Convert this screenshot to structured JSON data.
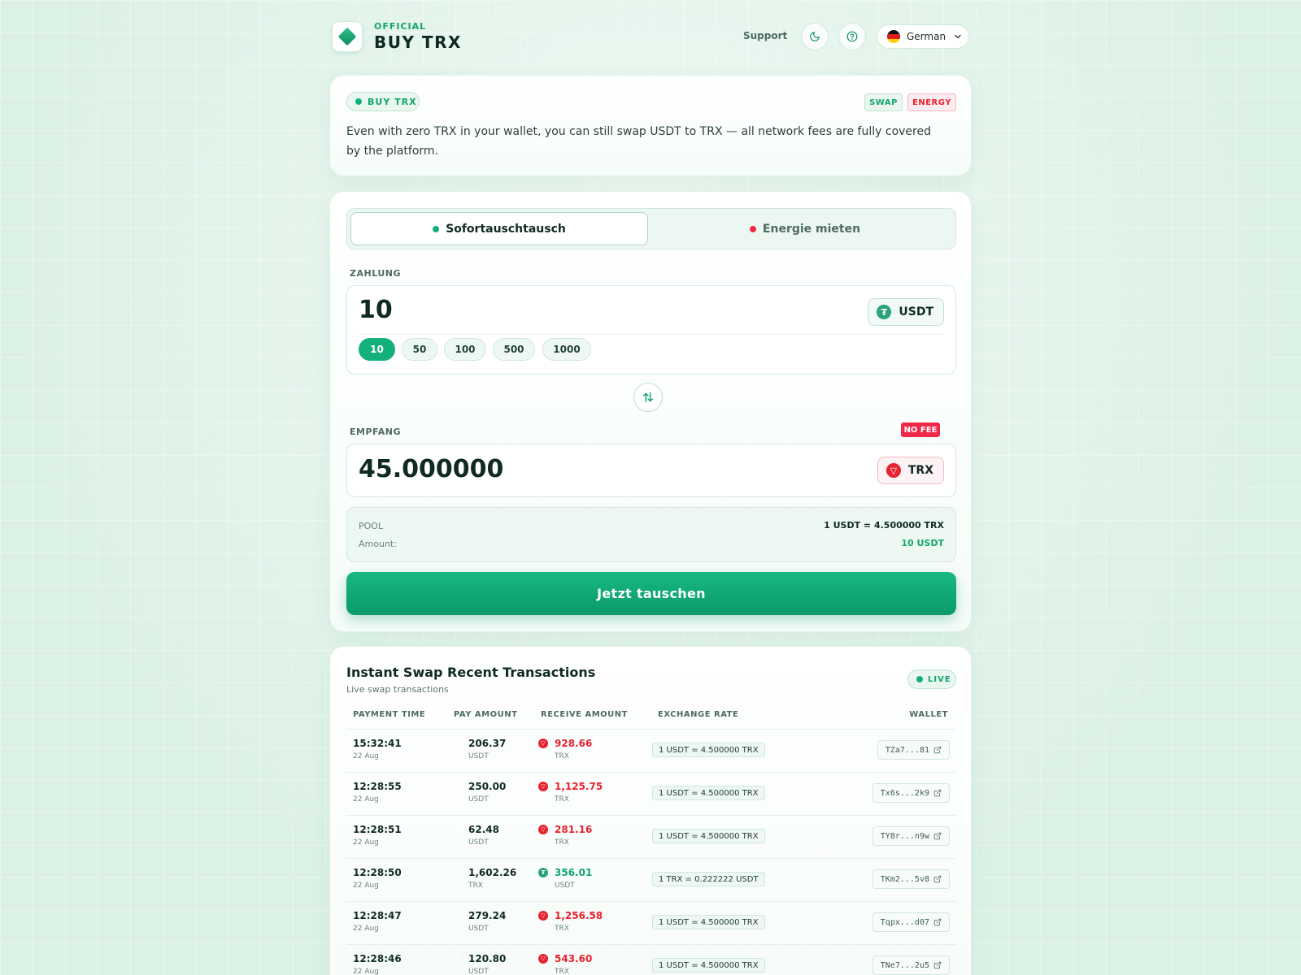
{
  "header": {
    "brand_top": "OFFICIAL",
    "brand_name": "BUY TRX",
    "support": "Support",
    "language": "German"
  },
  "info": {
    "badge": "BUY TRX",
    "tag_swap": "SWAP",
    "tag_energy": "ENERGY",
    "text": "Even with zero TRX in your wallet, you can still swap USDT to TRX — all network fees are fully covered by the platform."
  },
  "swap": {
    "tab_instant": "Sofortauschtausch",
    "tab_energy": "Energie mieten",
    "pay_label": "ZAHLUNG",
    "pay_amount": "10",
    "pay_token": "USDT",
    "quick_amounts": [
      "10",
      "50",
      "100",
      "500",
      "1000"
    ],
    "receive_label": "EMPFANG",
    "no_fee": "NO FEE",
    "receive_amount": "45.000000",
    "receive_token": "TRX",
    "pool_label": "POOL",
    "pool_rate": "1 USDT = 4.500000 TRX",
    "amount_label": "Amount:",
    "amount_value": "10 USDT",
    "cta": "Jetzt tauschen"
  },
  "transactions": {
    "title": "Instant Swap Recent Transactions",
    "subtitle": "Live swap transactions",
    "live": "LIVE",
    "headers": {
      "time": "PAYMENT TIME",
      "pay": "PAY AMOUNT",
      "receive": "RECEIVE AMOUNT",
      "rate": "EXCHANGE RATE",
      "wallet": "WALLET"
    },
    "rows": [
      {
        "time": "15:32:41",
        "date": "22 Aug",
        "pay": "206.37",
        "pay_unit": "USDT",
        "recv": "928.66",
        "recv_unit": "TRX",
        "rate": "1 USDT = 4.500000 TRX",
        "wallet": "TZa7...81"
      },
      {
        "time": "12:28:55",
        "date": "22 Aug",
        "pay": "250.00",
        "pay_unit": "USDT",
        "recv": "1,125.75",
        "recv_unit": "TRX",
        "rate": "1 USDT = 4.500000 TRX",
        "wallet": "Tx6s...2k9"
      },
      {
        "time": "12:28:51",
        "date": "22 Aug",
        "pay": "62.48",
        "pay_unit": "USDT",
        "recv": "281.16",
        "recv_unit": "TRX",
        "rate": "1 USDT = 4.500000 TRX",
        "wallet": "TY8r...n9w"
      },
      {
        "time": "12:28:50",
        "date": "22 Aug",
        "pay": "1,602.26",
        "pay_unit": "TRX",
        "recv": "356.01",
        "recv_unit": "USDT",
        "rate": "1 TRX = 0.222222 USDT",
        "wallet": "TKm2...5v8"
      },
      {
        "time": "12:28:47",
        "date": "22 Aug",
        "pay": "279.24",
        "pay_unit": "USDT",
        "recv": "1,256.58",
        "recv_unit": "TRX",
        "rate": "1 USDT = 4.500000 TRX",
        "wallet": "Tqpx...d07"
      },
      {
        "time": "12:28:46",
        "date": "22 Aug",
        "pay": "120.80",
        "pay_unit": "USDT",
        "recv": "543.60",
        "recv_unit": "TRX",
        "rate": "1 USDT = 4.500000 TRX",
        "wallet": "TNe7...2u5"
      }
    ]
  },
  "colors": {
    "accent": "#14b07a",
    "usdt": "#2aa37a",
    "trx": "#e8222f",
    "no_fee": "#f0294a"
  }
}
